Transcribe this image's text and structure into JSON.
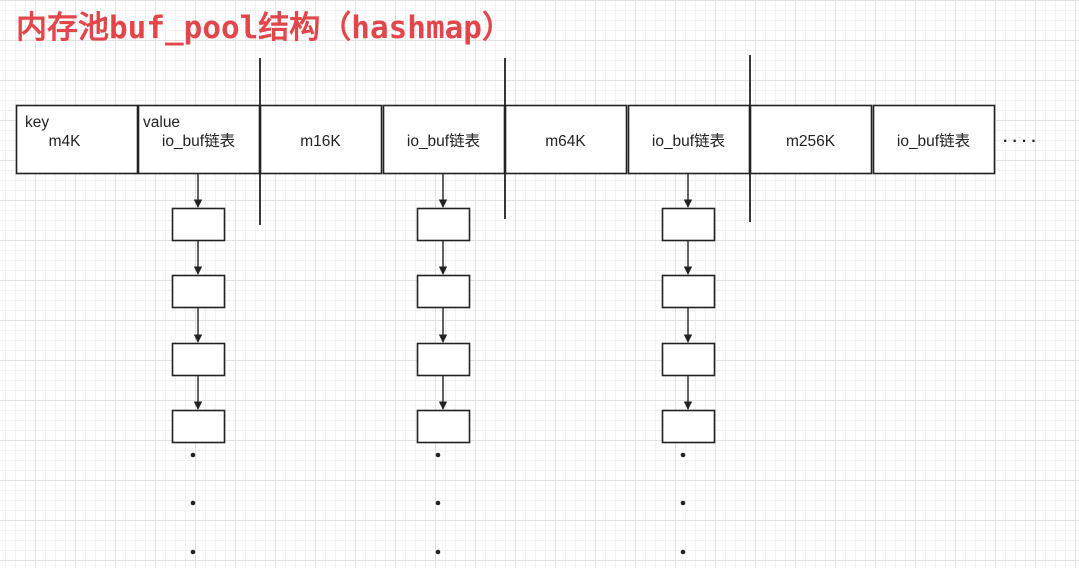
{
  "title": "内存池buf_pool结构（hashmap）",
  "colors": {
    "title": "#e2464b",
    "stroke": "#222222",
    "grid": "#e2e2e2"
  },
  "table": {
    "header": {
      "key": "key",
      "value": "value"
    },
    "cells": [
      "m4K",
      "io_buf链表",
      "m16K",
      "io_buf链表",
      "m64K",
      "io_buf链表",
      "m256K",
      "io_buf链表"
    ],
    "ellipsis": "· · · ·"
  },
  "linked_lists": {
    "nodes_per_list": 4,
    "continuation": "⋮"
  }
}
